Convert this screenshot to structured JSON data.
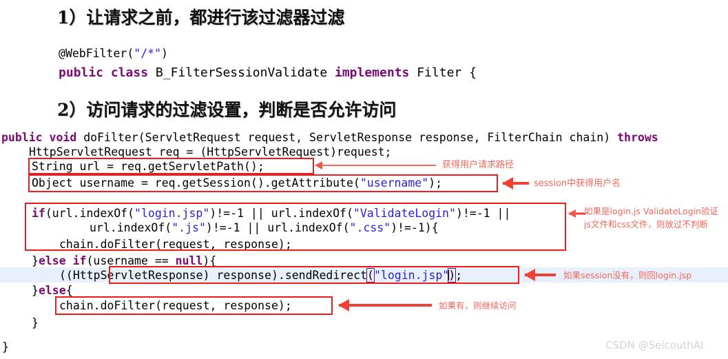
{
  "headings": [
    {
      "text": "1）让请求之前，都进行该过滤器过滤"
    },
    {
      "text": "2）访问请求的过滤设置，判断是否允许访问"
    }
  ],
  "code_block_1": {
    "line1_annotation": "@WebFilter(\"/*\")",
    "line1_at": "@",
    "line1_name": "WebFilter(",
    "line1_string": "\"/*\"",
    "line1_close": ")",
    "line2_kw1": "public",
    "line2_kw2": "class",
    "line2_classname": "B_FilterSessionValidate",
    "line2_kw3": "implements",
    "line2_iface": "Filter {"
  },
  "code_block_2": {
    "l1_kw1": "public",
    "l1_kw2": "void",
    "l1_body": "doFilter(ServletRequest request, ServletResponse response, FilterChain chain) ",
    "l1_kw3": "throws",
    "l2": "HttpServletRequest req = (HttpServletRequest)request;",
    "l3": "String url = req.getServletPath();",
    "l4_pre": "Object username = req.getSession().getAttribute(",
    "l4_str": "\"username\"",
    "l4_post": ");",
    "l5_kw": "if",
    "l5_a": "(url.indexOf(",
    "l5_s1": "\"login.jsp\"",
    "l5_b": ")!=-1 || url.indexOf(",
    "l5_s2": "\"ValidateLogin\"",
    "l5_c": ")!=-1 ||",
    "l6_a": "url.indexOf(",
    "l6_s1": "\".js\"",
    "l6_b": ")!=-1 || url.indexOf(",
    "l6_s2": "\".css\"",
    "l6_c": ")!=-1){",
    "l7": "chain.doFilter(request, response);",
    "l8_a": "}",
    "l8_kw1": "else",
    "l8_b": " ",
    "l8_kw2": "if",
    "l8_c": "(username == ",
    "l8_kw3": "null",
    "l8_d": "){",
    "l9_a": "((HttpServletResponse) response).sendRedirect",
    "l9_paren_open": "(",
    "l9_str": "\"login.jsp\"",
    "l9_paren_close": ")",
    "l9_end": ";",
    "l10_a": "}",
    "l10_kw": "else",
    "l10_b": "{",
    "l11": "chain.doFilter(request, response);",
    "l12": "}",
    "l13": "}"
  },
  "annotations": [
    {
      "id": "note-url-path",
      "text": "获得用户请求路径"
    },
    {
      "id": "note-session-user",
      "text": "session中获得用户名"
    },
    {
      "id": "note-passthrough-1",
      "text": "如果是login.js ValidateLogin验证"
    },
    {
      "id": "note-passthrough-2",
      "text": "js文件和css文件，则放过不判断"
    },
    {
      "id": "note-no-session",
      "text": "如果session没有，则回login.jsp"
    },
    {
      "id": "note-continue",
      "text": "如果有，则继续访问"
    }
  ],
  "watermark": {
    "text": "CSDN @SelcouthAI"
  },
  "colors": {
    "keyword": "#7b0a75",
    "string": "#2a21e0",
    "annotation_red": "#f4685c",
    "box_red": "#ee1c1c",
    "highlight_line": "#e8f0fb",
    "watermark": "#d4d4d4"
  }
}
